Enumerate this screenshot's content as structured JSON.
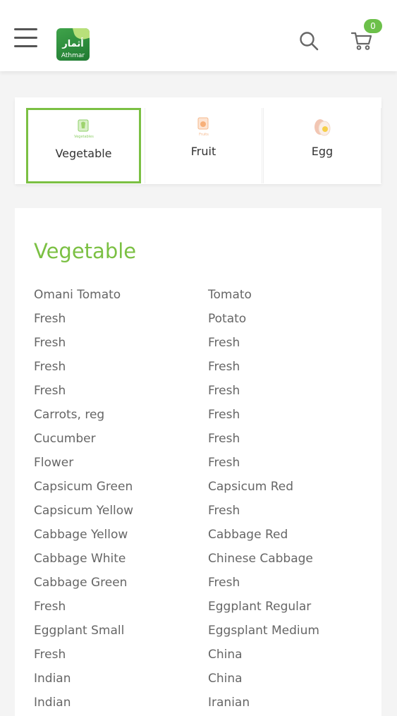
{
  "header": {
    "logo_arabic": "أثمار",
    "logo_text": "Athmar",
    "cart_count": "0"
  },
  "tabs": [
    {
      "label": "Vegetable",
      "active": true,
      "icon": "vegetables-icon",
      "icon_caption": "Vegetables"
    },
    {
      "label": "Fruit",
      "active": false,
      "icon": "fruits-icon",
      "icon_caption": "Fruits"
    },
    {
      "label": "Egg",
      "active": false,
      "icon": "egg-icon",
      "icon_caption": ""
    }
  ],
  "section": {
    "title": "Vegetable"
  },
  "items_left": [
    "Omani Tomato",
    "Fresh",
    "Fresh",
    "Fresh",
    "Fresh",
    "Carrots, reg",
    "Cucumber",
    "Flower",
    "Capsicum Green",
    "Capsicum Yellow",
    "Cabbage Yellow",
    "Cabbage White",
    "Cabbage Green",
    "Fresh",
    "Eggplant Small",
    "Fresh",
    "Indian",
    "Indian"
  ],
  "items_right": [
    "Tomato",
    "Potato",
    "Fresh",
    "Fresh",
    "Fresh",
    "Fresh",
    "Fresh",
    "Fresh",
    "Capsicum Red",
    "Fresh",
    "Cabbage Red",
    "Chinese Cabbage",
    "Fresh",
    "Eggplant Regular",
    "Eggsplant Medium",
    "China",
    "China",
    "Iranian"
  ],
  "colors": {
    "accent": "#7bc043",
    "badge": "#6cc04a",
    "text": "#666666"
  }
}
